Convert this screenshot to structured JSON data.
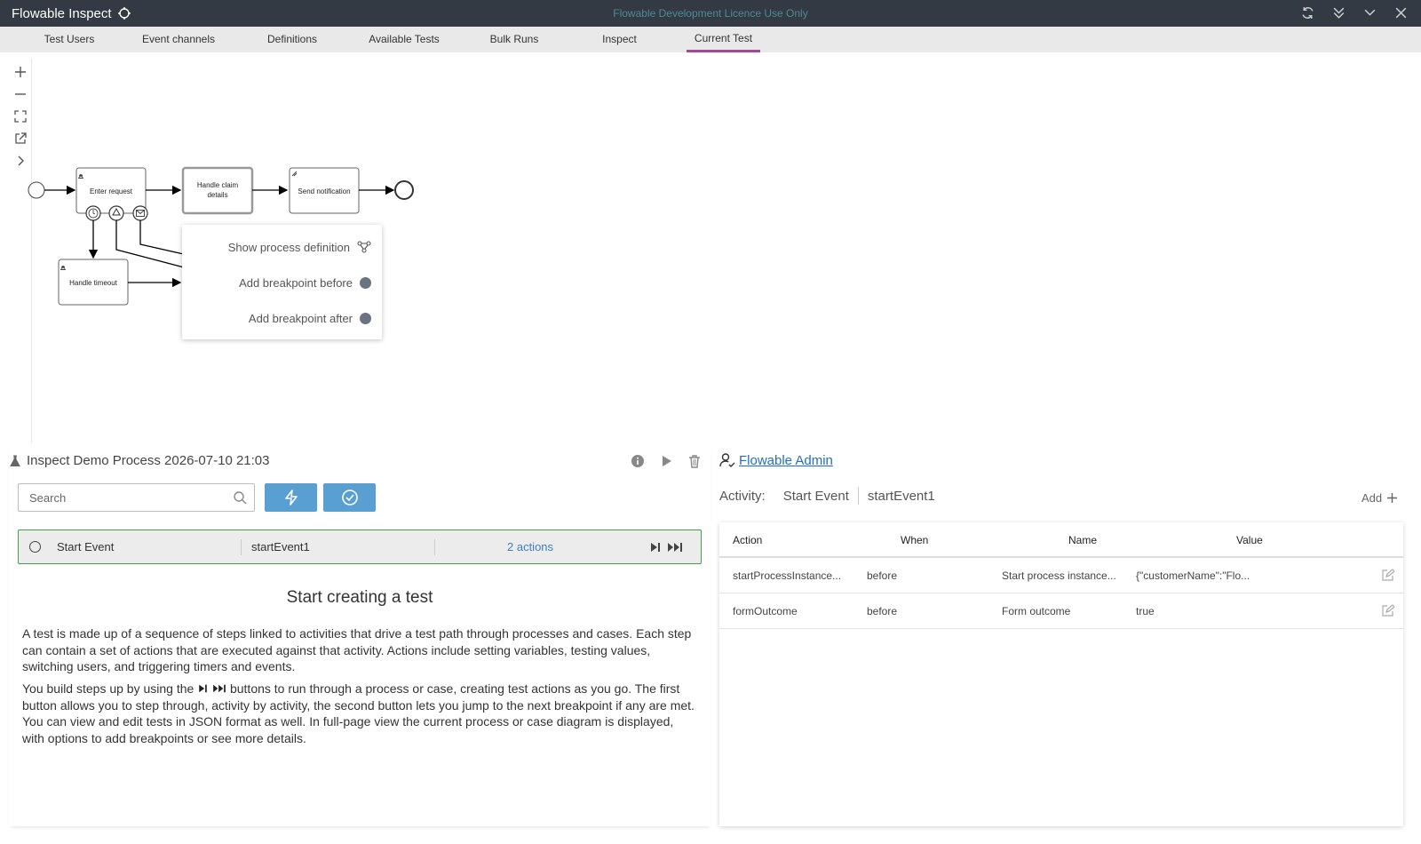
{
  "window": {
    "app_title": "Flowable Inspect",
    "licence": "Flowable Development Licence Use Only"
  },
  "tabs": [
    "Test Users",
    "Event channels",
    "Definitions",
    "Available Tests",
    "Bulk Runs",
    "Inspect",
    "Current Test"
  ],
  "active_tab": "Current Test",
  "diagram": {
    "tasks": {
      "enter_request": "Enter request",
      "handle_claim": "Handle claim details",
      "send_notification": "Send notification",
      "handle_timeout": "Handle timeout"
    },
    "context_menu": {
      "show_definition": "Show process definition",
      "bp_before": "Add breakpoint before",
      "bp_after": "Add breakpoint after"
    }
  },
  "test": {
    "title": "Inspect Demo Process 2026-07-10 21:03",
    "search_placeholder": "Search",
    "step": {
      "name": "Start Event",
      "id": "startEvent1",
      "actions": "2 actions"
    },
    "info": {
      "heading": "Start creating a test",
      "para1": "A test is made up of a sequence of steps linked to activities that drive a test path through processes and cases. Each step can contain a set of actions that are executed against that activity. Actions include setting variables, testing values, switching users, and triggering timers and events.",
      "para2_a": "You build steps up by using the",
      "para2_b": "buttons to run through a process or case, creating test actions as you go. The first button allows you to step through, activity by activity, the second button lets you jump to the next breakpoint if any are met. You can view and edit tests in JSON format as well. In full-page view the current process or case diagram is displayed, with options to add breakpoints or see more details."
    }
  },
  "right": {
    "user": "Flowable Admin",
    "activity_label": "Activity:",
    "activity_name": "Start Event",
    "activity_id": "startEvent1",
    "add_label": "Add",
    "columns": [
      "Action",
      "When",
      "Name",
      "Value"
    ],
    "rows": [
      {
        "action": "startProcessInstance...",
        "when": "before",
        "name": "Start process instance...",
        "value": "{\"customerName\":\"Flo..."
      },
      {
        "action": "formOutcome",
        "when": "before",
        "name": "Form outcome",
        "value": "true"
      }
    ]
  },
  "colors": {
    "titlebar": "#333a43",
    "active_tab": "#a5479a",
    "primary_button": "#5a9fd1",
    "step_border": "#43a047",
    "link": "#1f6fc5"
  }
}
